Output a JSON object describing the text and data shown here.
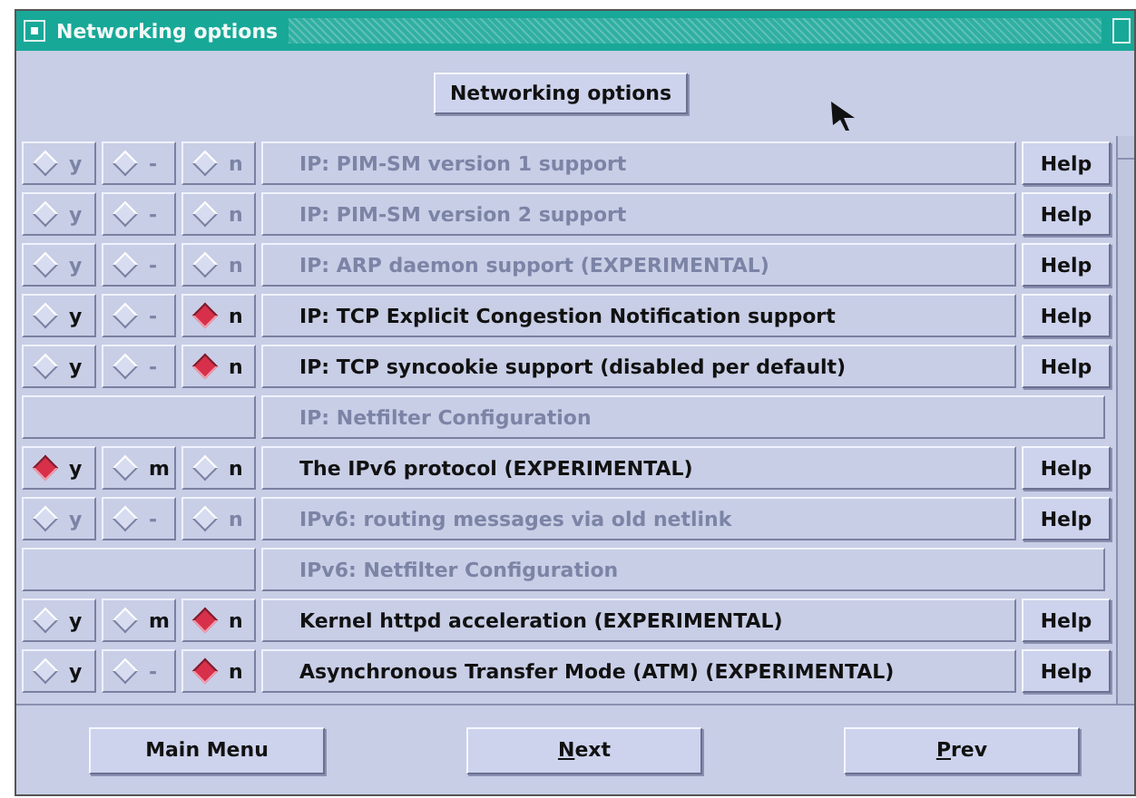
{
  "window": {
    "title": "Networking options"
  },
  "header_button": "Networking options",
  "rows": [
    {
      "kind": "option",
      "disabled": true,
      "label": "IP: PIM-SM version 1 support",
      "help": "Help",
      "choices": [
        {
          "label": "y",
          "selected": false,
          "disabled": true
        },
        {
          "label": "-",
          "selected": false,
          "disabled": true
        },
        {
          "label": "n",
          "selected": false,
          "disabled": true
        }
      ]
    },
    {
      "kind": "option",
      "disabled": true,
      "label": "IP: PIM-SM version 2 support",
      "help": "Help",
      "choices": [
        {
          "label": "y",
          "selected": false,
          "disabled": true
        },
        {
          "label": "-",
          "selected": false,
          "disabled": true
        },
        {
          "label": "n",
          "selected": false,
          "disabled": true
        }
      ]
    },
    {
      "kind": "option",
      "disabled": true,
      "label": "IP: ARP daemon support (EXPERIMENTAL)",
      "help": "Help",
      "choices": [
        {
          "label": "y",
          "selected": false,
          "disabled": true
        },
        {
          "label": "-",
          "selected": false,
          "disabled": true
        },
        {
          "label": "n",
          "selected": false,
          "disabled": true
        }
      ]
    },
    {
      "kind": "option",
      "disabled": false,
      "label": "IP: TCP Explicit Congestion Notification support",
      "help": "Help",
      "choices": [
        {
          "label": "y",
          "selected": false,
          "disabled": false
        },
        {
          "label": "-",
          "selected": false,
          "disabled": true
        },
        {
          "label": "n",
          "selected": true,
          "disabled": false
        }
      ]
    },
    {
      "kind": "option",
      "disabled": false,
      "label": "IP: TCP syncookie support (disabled per default)",
      "help": "Help",
      "choices": [
        {
          "label": "y",
          "selected": false,
          "disabled": false
        },
        {
          "label": "-",
          "selected": false,
          "disabled": true
        },
        {
          "label": "n",
          "selected": true,
          "disabled": false
        }
      ]
    },
    {
      "kind": "heading",
      "disabled": true,
      "label": "IP: Netfilter Configuration"
    },
    {
      "kind": "option",
      "disabled": false,
      "label": "The IPv6 protocol (EXPERIMENTAL)",
      "help": "Help",
      "choices": [
        {
          "label": "y",
          "selected": true,
          "disabled": false
        },
        {
          "label": "m",
          "selected": false,
          "disabled": false
        },
        {
          "label": "n",
          "selected": false,
          "disabled": false
        }
      ]
    },
    {
      "kind": "option",
      "disabled": true,
      "label": "IPv6: routing messages via old netlink",
      "help": "Help",
      "choices": [
        {
          "label": "y",
          "selected": false,
          "disabled": true
        },
        {
          "label": "-",
          "selected": false,
          "disabled": true
        },
        {
          "label": "n",
          "selected": false,
          "disabled": true
        }
      ]
    },
    {
      "kind": "heading",
      "disabled": true,
      "label": "IPv6: Netfilter Configuration"
    },
    {
      "kind": "option",
      "disabled": false,
      "label": "Kernel httpd acceleration (EXPERIMENTAL)",
      "help": "Help",
      "choices": [
        {
          "label": "y",
          "selected": false,
          "disabled": false
        },
        {
          "label": "m",
          "selected": false,
          "disabled": false
        },
        {
          "label": "n",
          "selected": true,
          "disabled": false
        }
      ]
    },
    {
      "kind": "option",
      "disabled": false,
      "label": "Asynchronous Transfer Mode (ATM) (EXPERIMENTAL)",
      "help": "Help",
      "choices": [
        {
          "label": "y",
          "selected": false,
          "disabled": false
        },
        {
          "label": "-",
          "selected": false,
          "disabled": true
        },
        {
          "label": "n",
          "selected": true,
          "disabled": false
        }
      ]
    }
  ],
  "buttons": [
    {
      "label": "Main Menu",
      "mnemonic": false
    },
    {
      "label": "Next",
      "mnemonic": true
    },
    {
      "label": "Prev",
      "mnemonic": true
    }
  ]
}
